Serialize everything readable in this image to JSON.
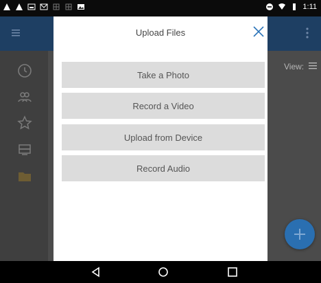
{
  "status_bar": {
    "time": "1:11",
    "left_icons": [
      "warning-icon",
      "warning-icon",
      "photo-icon",
      "mail-icon",
      "grid-icon",
      "grid-icon",
      "image-icon"
    ],
    "right_icons": [
      "minus-circle-icon",
      "wifi-icon",
      "battery-icon"
    ]
  },
  "app_bar": {
    "menu_icon": "menu-icon",
    "more_icon": "more-vertical-icon",
    "color": "#1e3f63"
  },
  "sidebar": {
    "items": [
      {
        "icon": "clock-icon"
      },
      {
        "icon": "people-icon"
      },
      {
        "icon": "star-icon"
      },
      {
        "icon": "storage-icon"
      },
      {
        "icon": "folder-icon"
      }
    ]
  },
  "main": {
    "view_label": "View:"
  },
  "dialog": {
    "title": "Upload Files",
    "options": [
      {
        "label": "Take a Photo"
      },
      {
        "label": "Record a Video"
      },
      {
        "label": "Upload from Device"
      },
      {
        "label": "Record Audio"
      }
    ],
    "accent": "#2a73b8"
  },
  "fab": {
    "icon": "plus-icon",
    "color": "#2a6fb1"
  },
  "nav_bar": {
    "back": "back-icon",
    "home": "home-icon",
    "recents": "recents-icon"
  }
}
